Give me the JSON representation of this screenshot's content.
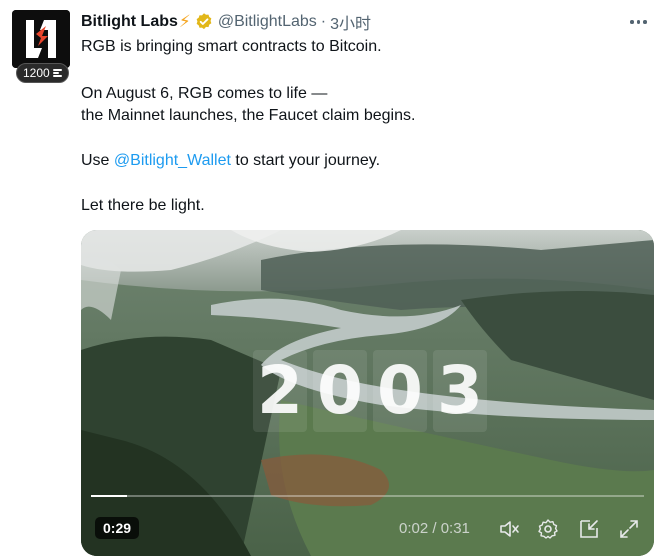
{
  "author": {
    "display_name": "Bitlight Labs",
    "name_emoji": "⚡",
    "handle": "@BitlightLabs",
    "separator": "·",
    "time": "3小时",
    "avatar_badge": "1200"
  },
  "tweet": {
    "line1": "RGB is bringing smart contracts to Bitcoin.",
    "line2": "On August 6, RGB comes to life —",
    "line3": "the Mainnet launches, the Faucet claim begins.",
    "line4_prefix": "Use ",
    "line4_mention": "@Bitlight_Wallet",
    "line4_suffix": " to start your journey.",
    "line5": "Let there be light."
  },
  "video": {
    "overlay_digits": [
      "2",
      "0",
      "0",
      "3"
    ],
    "duration_badge": "0:29",
    "timecode": "0:02 / 0:31",
    "progress": 0.065
  },
  "icons": {
    "more": "more-options-icon",
    "verified": "verified-badge-icon",
    "mute": "mute-icon",
    "settings": "settings-icon",
    "minimize": "minimize-player-icon",
    "fullscreen": "fullscreen-icon"
  },
  "colors": {
    "accent": "#1d9bf0",
    "verified_gold": "#e2b719",
    "text": "#0f1419",
    "secondary": "#536471"
  }
}
